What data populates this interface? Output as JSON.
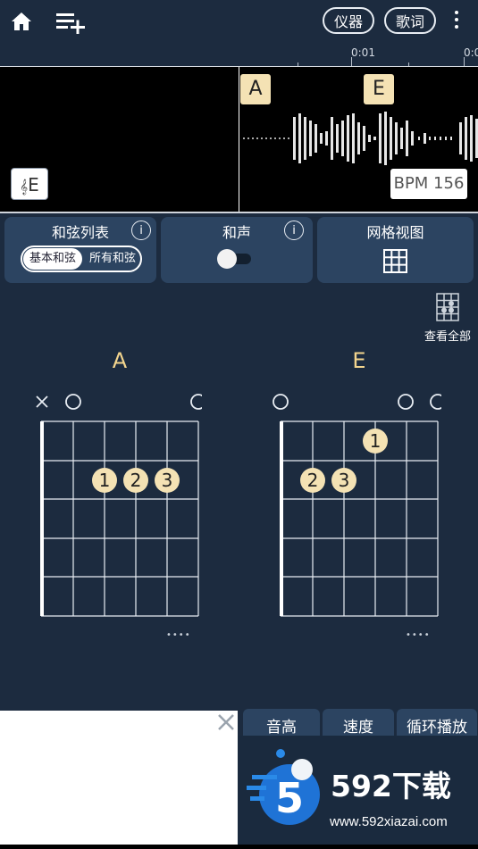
{
  "toolbar": {
    "instrument_label": "仪器",
    "lyrics_label": "歌词"
  },
  "timeline": {
    "labels": [
      "0:01",
      "0:0"
    ]
  },
  "waveform": {
    "chord_tags": [
      "A",
      "E"
    ],
    "key_label": "E",
    "bpm_label": "BPM 156"
  },
  "panels": {
    "chord_list": {
      "title": "和弦列表",
      "info": "i",
      "segment_basic": "基本和弦",
      "segment_all": "所有和弦"
    },
    "harmony": {
      "title": "和声",
      "info": "i",
      "toggle_on": false
    },
    "grid_view": {
      "title": "网格视图"
    }
  },
  "view_all_label": "查看全部",
  "chords": [
    {
      "name": "A",
      "more": "••••"
    },
    {
      "name": "E",
      "more": "••••"
    }
  ],
  "bottom_tabs": [
    "音高",
    "速度",
    "循环播放"
  ],
  "watermark": {
    "brand": "592下载",
    "url": "www.592xiazai.com"
  },
  "colors": {
    "background": "#1c2b3f",
    "panel": "#2c4461",
    "chord_name": "#f3d58e",
    "finger_dot": "#f4e2b4"
  }
}
